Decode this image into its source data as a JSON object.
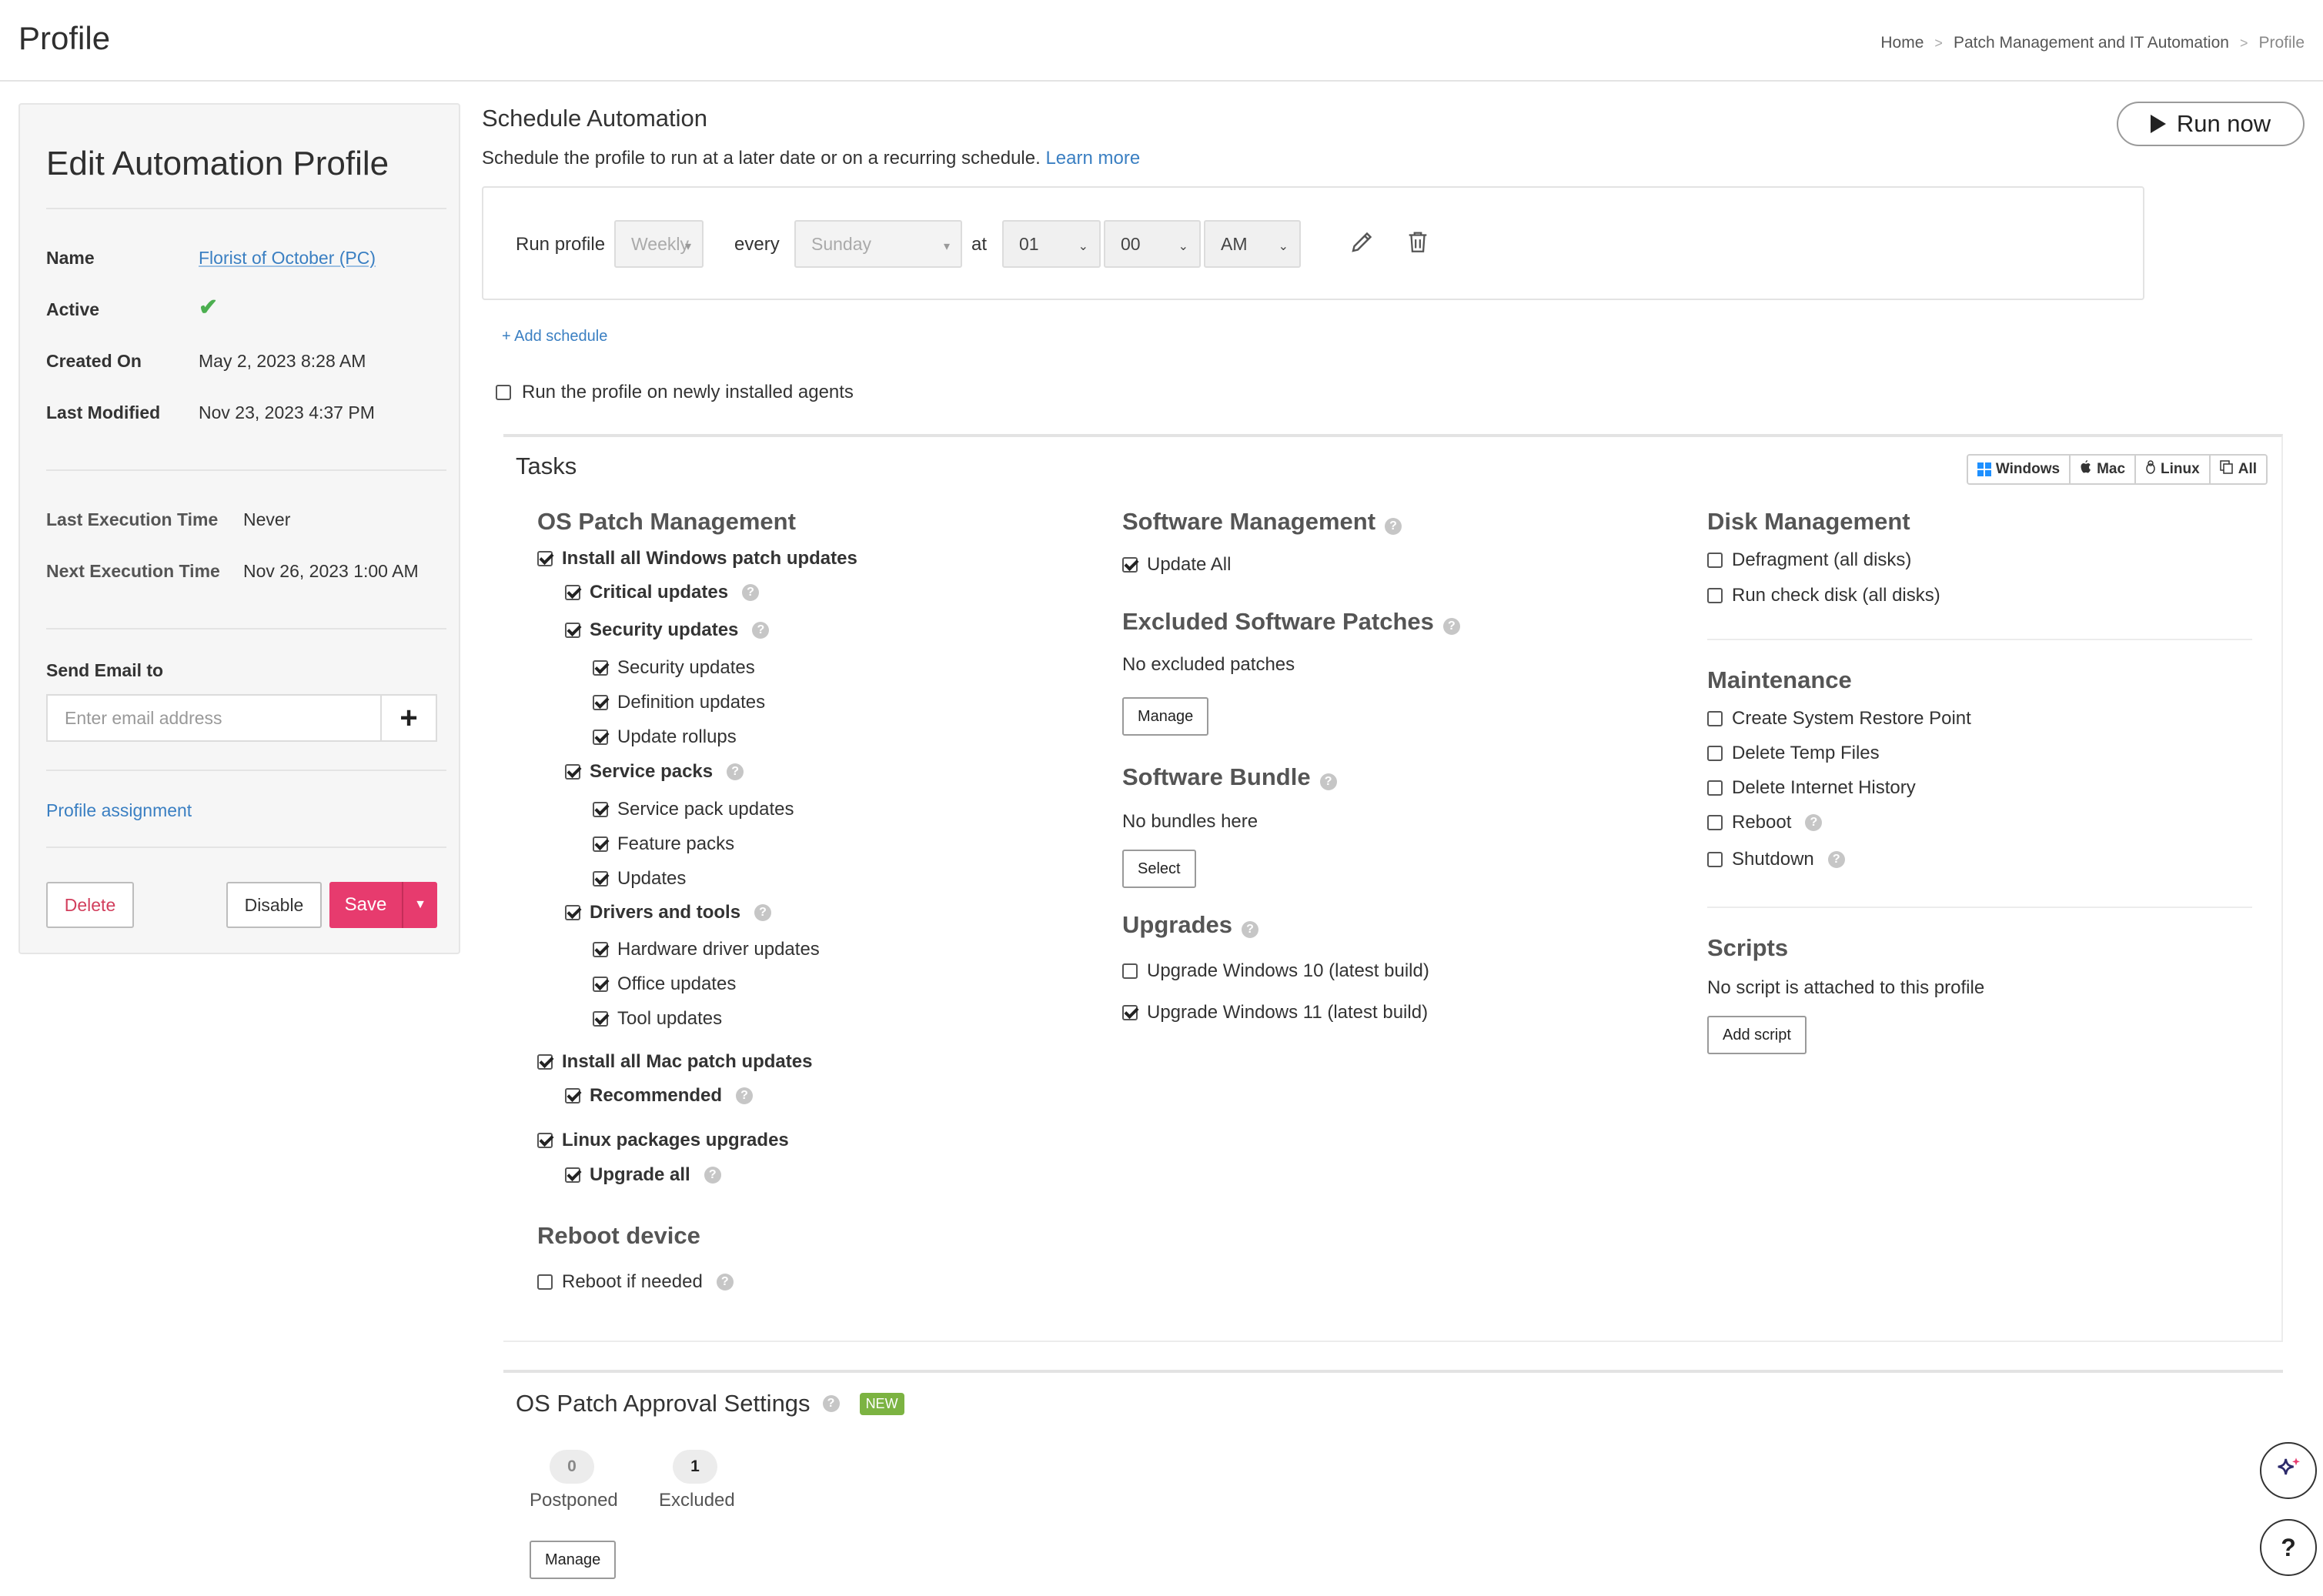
{
  "header": {
    "title": "Profile",
    "breadcrumb": [
      "Home",
      "Patch Management and IT Automation",
      "Profile"
    ]
  },
  "left_card": {
    "title": "Edit Automation Profile",
    "fields": {
      "name_label": "Name",
      "name_value": "Florist of October (PC)",
      "active_label": "Active",
      "active_value": "✔",
      "created_label": "Created On",
      "created_value": "May 2, 2023 8:28 AM",
      "modified_label": "Last Modified",
      "modified_value": "Nov 23, 2023 4:37 PM",
      "last_exec_label": "Last Execution Time",
      "last_exec_value": "Never",
      "next_exec_label": "Next Execution Time",
      "next_exec_value": "Nov 26, 2023 1:00 AM"
    },
    "email": {
      "label": "Send Email to",
      "placeholder": "Enter email address",
      "add": "+"
    },
    "profile_assignment": "Profile assignment",
    "buttons": {
      "delete": "Delete",
      "disable": "Disable",
      "save": "Save"
    }
  },
  "schedule": {
    "title": "Schedule Automation",
    "description": "Schedule the profile to run at a later date or on a recurring schedule.",
    "learn_more": "Learn more",
    "run_now": "Run now",
    "run_profile_label": "Run profile",
    "frequency": "Weekly",
    "every_label": "every",
    "day": "Sunday",
    "at_label": "at",
    "hour": "01",
    "minute": "00",
    "ampm": "AM",
    "add_schedule": "+ Add schedule",
    "newly_installed": "Run the profile on newly installed agents",
    "newly_installed_checked": false
  },
  "tasks": {
    "title": "Tasks",
    "os_filter": [
      "Windows",
      "Mac",
      "Linux",
      "All"
    ],
    "os_patch": {
      "title": "OS Patch Management",
      "install_windows": "Install all Windows patch updates",
      "critical": "Critical updates",
      "security": "Security updates",
      "security_sub": [
        "Security updates",
        "Definition updates",
        "Update rollups"
      ],
      "service_packs": "Service packs",
      "service_sub": [
        "Service pack updates",
        "Feature packs",
        "Updates"
      ],
      "drivers": "Drivers and tools",
      "drivers_sub": [
        "Hardware driver updates",
        "Office updates",
        "Tool updates"
      ],
      "install_mac": "Install all Mac patch updates",
      "recommended": "Recommended",
      "linux": "Linux packages upgrades",
      "upgrade_all": "Upgrade all"
    },
    "reboot": {
      "title": "Reboot device",
      "if_needed": "Reboot if needed"
    },
    "software": {
      "title": "Software Management",
      "update_all": "Update All",
      "excluded_title": "Excluded Software Patches",
      "no_excluded": "No excluded patches",
      "manage": "Manage",
      "bundle_title": "Software Bundle",
      "no_bundles": "No bundles here",
      "select": "Select",
      "upgrades_title": "Upgrades",
      "win10": "Upgrade Windows 10 (latest build)",
      "win11": "Upgrade Windows 11 (latest build)"
    },
    "disk": {
      "title": "Disk Management",
      "defrag": "Defragment (all disks)",
      "checkdisk": "Run check disk (all disks)"
    },
    "maintenance": {
      "title": "Maintenance",
      "items": [
        "Create System Restore Point",
        "Delete Temp Files",
        "Delete Internet History",
        "Reboot",
        "Shutdown"
      ]
    },
    "scripts": {
      "title": "Scripts",
      "none": "No script is attached to this profile",
      "add": "Add script"
    }
  },
  "approval": {
    "title": "OS Patch Approval Settings",
    "badge": "NEW",
    "postponed_count": "0",
    "postponed_label": "Postponed",
    "excluded_count": "1",
    "excluded_label": "Excluded",
    "manage": "Manage"
  },
  "help_fab": "?",
  "colors": {
    "accent": "#e73b6e",
    "link": "#3a7fc2",
    "success": "#4caf50",
    "new_badge": "#7cb342"
  }
}
